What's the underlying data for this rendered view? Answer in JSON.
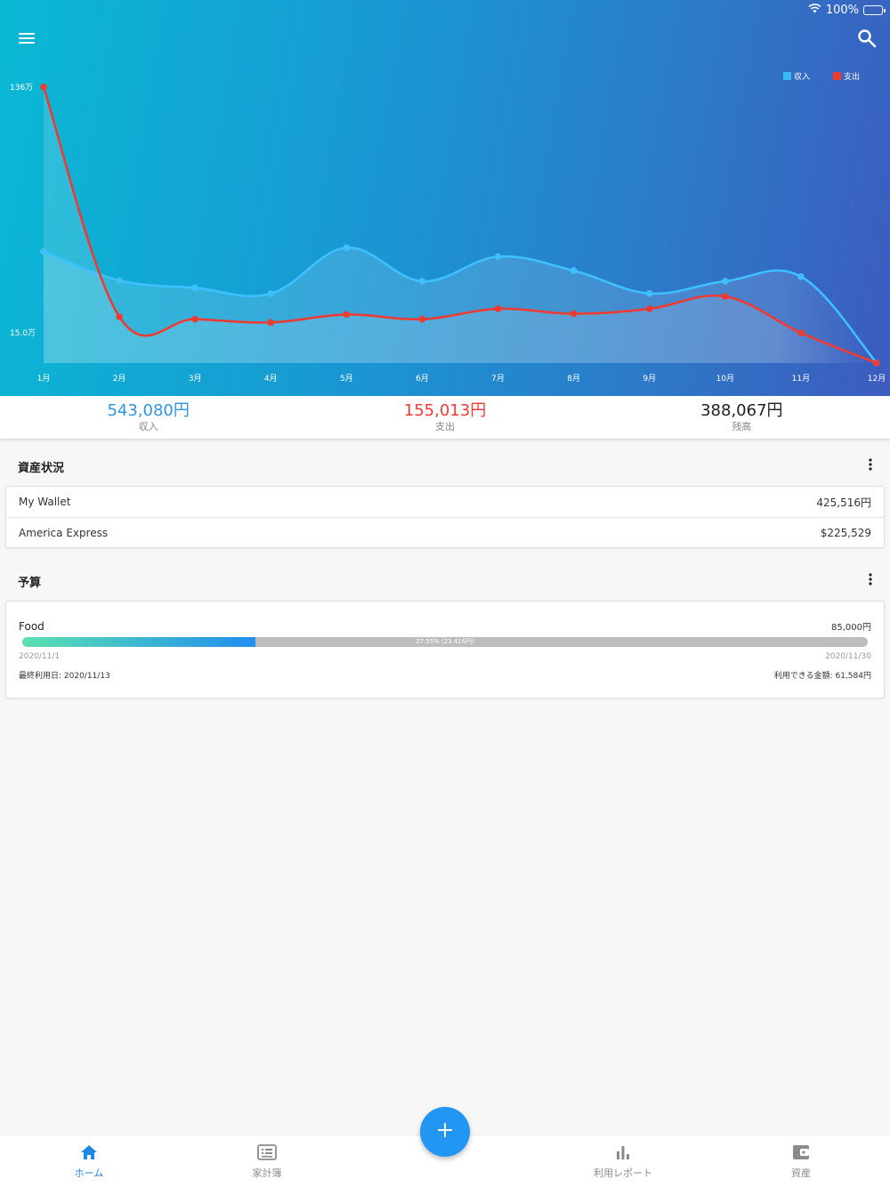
{
  "status_bar": {
    "battery": "100%"
  },
  "legend": [
    {
      "label": "収入",
      "color": "#39b8f8"
    },
    {
      "label": "支出",
      "color": "#ee3b32"
    }
  ],
  "chart_data": {
    "type": "line",
    "categories": [
      "1月",
      "2月",
      "3月",
      "4月",
      "5月",
      "6月",
      "7月",
      "8月",
      "9月",
      "10月",
      "11月",
      "12月"
    ],
    "series": [
      {
        "name": "収入",
        "color": "#3ec0ff",
        "values": [
          55.0,
          40.7,
          37.0,
          34.2,
          56.8,
          40.3,
          52.4,
          45.5,
          34.3,
          40.3,
          42.6,
          0
        ]
      },
      {
        "name": "支出",
        "color": "#ee3b32",
        "values": [
          136.0,
          22.8,
          21.6,
          20.0,
          23.9,
          21.6,
          26.7,
          24.3,
          26.7,
          32.8,
          14.9,
          0
        ]
      }
    ],
    "y_tick_labels": [
      {
        "value": 136.0,
        "label": "136万"
      },
      {
        "value": 15.0,
        "label": "15.0万"
      }
    ],
    "grid": false,
    "legend_position": "top-right"
  },
  "summary": {
    "income": {
      "value": "543,080円",
      "label": "収入",
      "color": "#2f95e0"
    },
    "expense": {
      "value": "155,013円",
      "label": "支出",
      "color": "#ee3b32"
    },
    "balance": {
      "value": "388,067円",
      "label": "残高",
      "color": "#222222"
    }
  },
  "assets": {
    "title": "資産状況",
    "accounts": [
      {
        "name": "My Wallet",
        "amount": "425,516円"
      },
      {
        "name": "America Express",
        "amount": "$225,529"
      }
    ]
  },
  "budget": {
    "title": "予算",
    "item": {
      "name": "Food",
      "amount": "85,000円",
      "progress": 0.2755,
      "progress_text": "27.55% (23,416円)",
      "start_date": "2020/11/1",
      "end_date": "2020/11/30",
      "last_used": "最終利用日: 2020/11/13",
      "available": "利用できる金額: 61,584円"
    }
  },
  "nav": {
    "home": "ホーム",
    "ledger": "家計簿",
    "report": "利用レポート",
    "assets": "資産"
  },
  "colors": {
    "accent": "#2196f3",
    "income": "#39b8f8",
    "expense": "#ee3b32"
  }
}
